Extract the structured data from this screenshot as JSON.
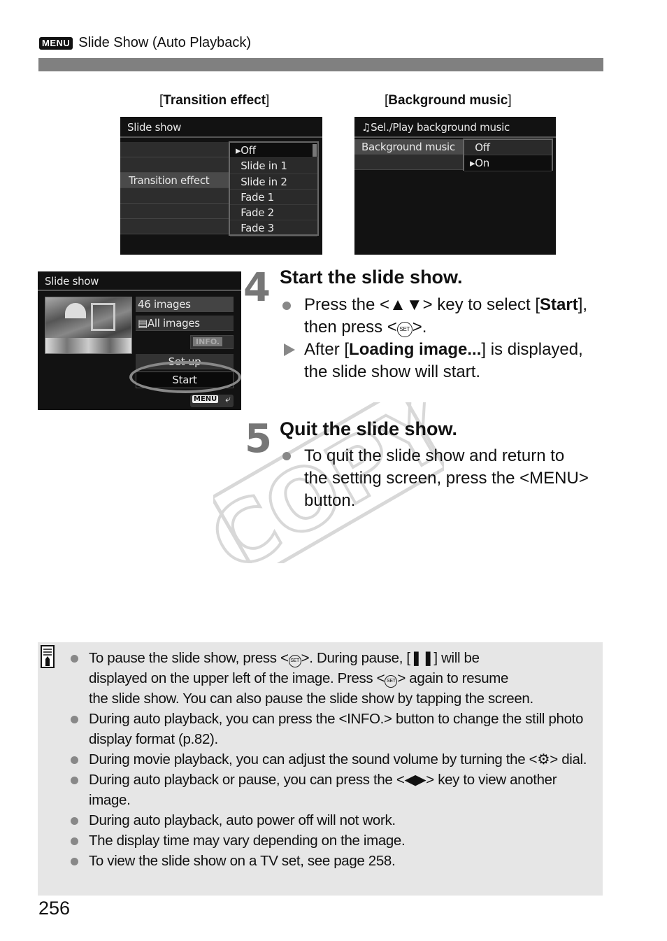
{
  "header": {
    "menu_badge": "MENU",
    "title": "Slide Show (Auto Playback)"
  },
  "captions": {
    "transition_effect": "Transition effect",
    "background_music": "Background music"
  },
  "screen_transition": {
    "title": "Slide show",
    "row_label": "Transition effect",
    "options": [
      "Off",
      "Slide in 1",
      "Slide in 2",
      "Fade 1",
      "Fade 2",
      "Fade 3"
    ],
    "selected": "Off"
  },
  "screen_music": {
    "title": "Sel./Play background music",
    "row_label": "Background music",
    "options": [
      "Off",
      "On"
    ],
    "selected": "On"
  },
  "screen_slideshow": {
    "title": "Slide show",
    "image_count": "46 images",
    "filter": "All images",
    "info_label": "INFO.",
    "setup_label": "Set up",
    "start_label": "Start",
    "menu_label": "MENU"
  },
  "step4": {
    "number": "4",
    "title": "Start the slide show.",
    "bullet_pre": "Press the <",
    "bullet_keys": "▲▼",
    "bullet_mid": "> key to select [",
    "bullet_bold": "Start",
    "bullet_post": "],",
    "bullet_line2_pre": "then press <",
    "set_icon": "SET",
    "bullet_line2_post": ">.",
    "result_pre": "After [",
    "result_bold": "Loading image...",
    "result_post": "] is displayed,",
    "result_line2": "the slide show will start."
  },
  "step5": {
    "number": "5",
    "title": "Quit the slide show.",
    "line1": "To quit the slide show and return to",
    "line2": "the setting screen, press the <MENU>",
    "line3": "button."
  },
  "watermark": "COPY",
  "notes": [
    {
      "lines": [
        [
          "To pause the slide show, press <",
          "SET",
          ">. During pause, [❚❚] will be"
        ],
        [
          "displayed on the upper left of the image. Press <",
          "SET",
          "> again to resume"
        ],
        [
          "the slide show. You can also pause the slide show by tapping the screen."
        ]
      ]
    },
    {
      "text": "During auto playback, you can press the <INFO.> button to change the still photo display format (p.82)."
    },
    {
      "text": "During movie playback, you can adjust the sound volume by turning the <⚙> dial."
    },
    {
      "text": "During auto playback or pause, you can press the <◀▶> key to view another image."
    },
    {
      "text": "During auto playback, auto power off will not work."
    },
    {
      "text": "The display time may vary depending on the image."
    },
    {
      "text": "To view the slide show on a TV set, see page 258."
    }
  ],
  "page_number": "256"
}
